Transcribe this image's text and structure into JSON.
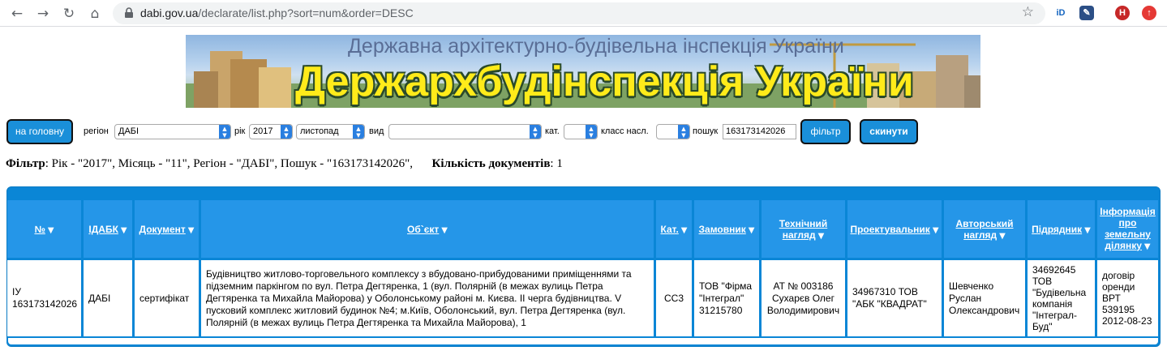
{
  "browser": {
    "url_host": "dabi.gov.ua",
    "url_path": "/declarate/list.php?sort=num&order=DESC"
  },
  "banner": {
    "subtitle": "Державна архітектурно-будівельна інспекція України",
    "title": "Держархбудінспекція України"
  },
  "toolbar": {
    "home_label": "на головну",
    "region_label": "регіон",
    "region_value": "ДАБІ",
    "year_label": "рік",
    "year_value": "2017",
    "month_value": "листопад",
    "type_label": "вид",
    "type_value": "",
    "cat_label": "кат.",
    "cat_value": "",
    "class_label": "класс насл.",
    "class_value": "",
    "search_label": "пошук",
    "search_value": "163173142026",
    "filter_label": "фільтр",
    "reset_label": "скинути"
  },
  "filter_summary": {
    "filter_bold": "Фільтр",
    "filter_text": ": Рік - \"2017\", Місяць - \"11\", Регіон - \"ДАБІ\", Пошук - \"163173142026\",",
    "count_bold": "Кількість документів",
    "count_text": ": 1"
  },
  "table": {
    "headers": {
      "num": "№",
      "idabk": "ІДАБК",
      "doc": "Документ",
      "object": "Об`єкт",
      "cat": "Кат.",
      "customer": "Замовник",
      "tech_1": "Технічний",
      "tech_2": "нагляд",
      "designer": "Проектувальник",
      "author_1": "Авторський",
      "author_2": "нагляд",
      "contractor": "Підрядник",
      "info_1": "Інформація",
      "info_2": "про",
      "info_3": "земельну",
      "info_4": "ділянку"
    },
    "row": {
      "num": "ІУ 163173142026",
      "idabk": "ДАБІ",
      "doc": "сертифікат",
      "object": "Будівництво житлово-торговельного комплексу з вбудовано-прибудованими приміщеннями та підземним паркінгом по вул. Петра Дегтяренка, 1 (вул. Полярній (в межах вулиць Петра Дегтяренка та Михайла Майорова) у Оболонському районі м. Києва. ІІ черга будівництва. V пусковий комплекс житловий будинок №4; м.Київ, Оболонський, вул. Петра Дегтяренка (вул. Полярній (в межах вулиць Петра Дегтяренка та Михайла Майорова), 1",
      "cat": "СС3",
      "customer": "ТОВ \"Фірма \"Інтеграл\" 31215780",
      "tech": "АТ № 003186 Сухарєв Олег Володимирович",
      "designer": "34967310 ТОВ \"АБК \"КВАДРАТ\"",
      "author": "Шевченко Руслан Олександрович",
      "contractor": "34692645 ТОВ \"Будівельна компанія \"Інтеграл-Буд\"",
      "land": "договір оренди ВРТ 539195 2012-08-23"
    }
  }
}
